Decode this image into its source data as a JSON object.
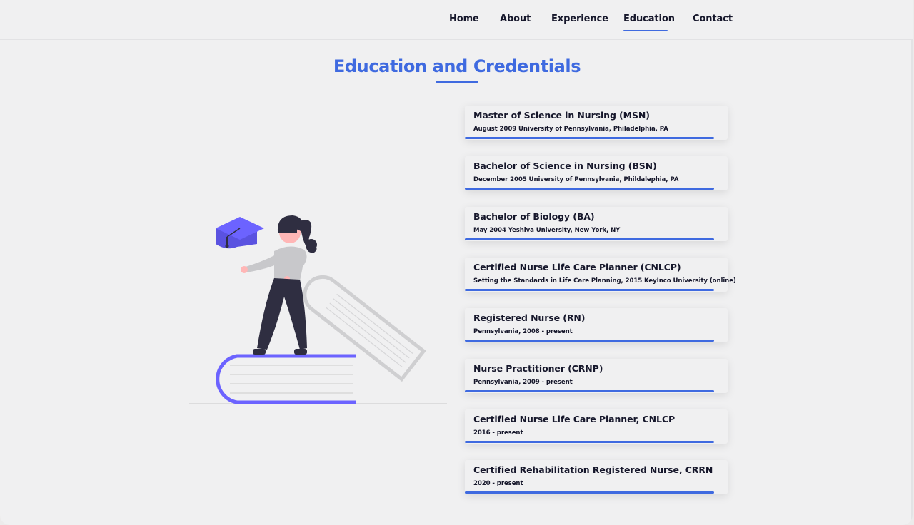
{
  "nav": {
    "items": [
      {
        "label": "Home"
      },
      {
        "label": "About"
      },
      {
        "label": "Experience"
      },
      {
        "label": "Education",
        "active": true
      },
      {
        "label": "Contact"
      }
    ]
  },
  "page": {
    "title": "Education and Credentials"
  },
  "credentials": [
    {
      "title": "Master of Science in Nursing (MSN)",
      "detail": "August 2009 University of Pennsylvania, Philadelphia, PA"
    },
    {
      "title": "Bachelor of Science in Nursing (BSN)",
      "detail": "December 2005 University of Pennsylvania, Phildalephia, PA"
    },
    {
      "title": "Bachelor of Biology (BA)",
      "detail": "May 2004 Yeshiva University, New York, NY"
    },
    {
      "title": "Certified Nurse Life Care Planner (CNLCP)",
      "detail": "Setting the Standards in Life Care Planning, 2015 KeyInco University (online)"
    },
    {
      "title": "Registered Nurse (RN)",
      "detail": "Pennsylvania, 2008 - present"
    },
    {
      "title": "Nurse Practitioner (CRNP)",
      "detail": "Pennsylvania, 2009 - present"
    },
    {
      "title": "Certified Nurse Life Care Planner, CNLCP",
      "detail": "2016 - present"
    },
    {
      "title": "Certified Rehabilitation Registered Nurse, CRRN",
      "detail": "2020 - present"
    }
  ],
  "colors": {
    "accent": "#3f6ae0",
    "illustration_purple": "#6c63ff",
    "text_dark": "#16172b",
    "background": "#f0f0f1"
  },
  "illustration": {
    "name": "graduate-with-books-illustration"
  }
}
